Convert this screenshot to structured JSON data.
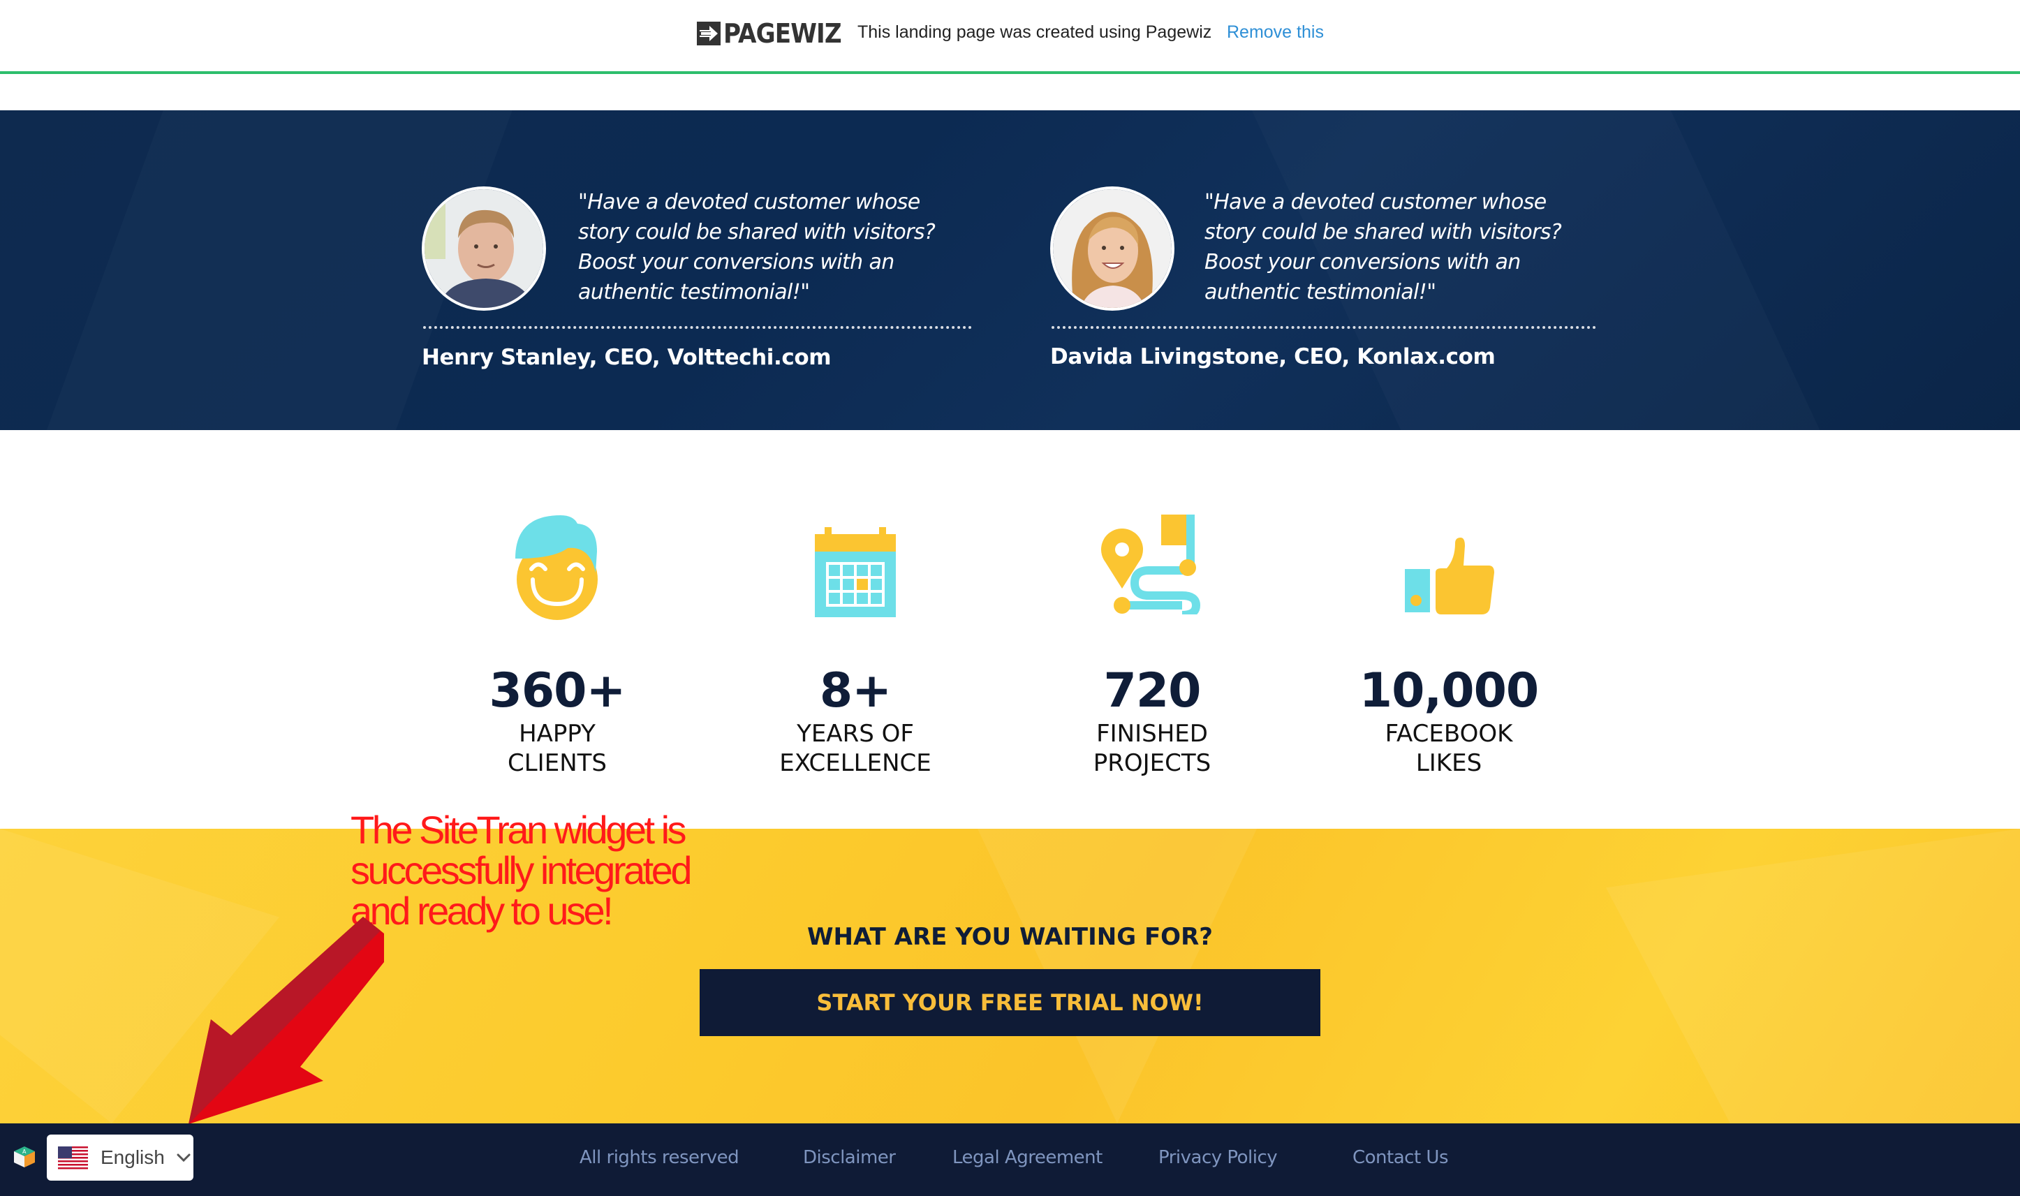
{
  "topbar": {
    "logo_text": "PAGEWIZ",
    "message": "This landing page was created using Pagewiz",
    "remove_link": "Remove this"
  },
  "testimonials": [
    {
      "quote": "\"Have a devoted customer whose story could be shared with visitors? Boost your conversions with an authentic testimonial!\"",
      "author": "Henry Stanley, CEO, Volttechi.com"
    },
    {
      "quote": "\"Have a devoted customer whose story could be shared with visitors? Boost your conversions with an authentic testimonial!\"",
      "author": "Davida Livingstone, CEO, Konlax.com"
    }
  ],
  "stats": [
    {
      "icon": "happy-face-icon",
      "value": "360+",
      "label_line1": "HAPPY",
      "label_line2": "CLIENTS"
    },
    {
      "icon": "calendar-icon",
      "value": "8+",
      "label_line1": "YEARS OF",
      "label_line2": "EXCELLENCE"
    },
    {
      "icon": "route-map-icon",
      "value": "720",
      "label_line1": "FINISHED",
      "label_line2": "PROJECTS"
    },
    {
      "icon": "thumbs-up-icon",
      "value": "10,000",
      "label_line1": "FACEBOOK",
      "label_line2": "LIKES"
    }
  ],
  "cta": {
    "heading": "WHAT ARE YOU WAITING FOR?",
    "button_label": "START YOUR FREE TRIAL NOW!"
  },
  "annotation": {
    "line1": "The SiteTran widget is",
    "line2": "successfully integrated",
    "line3": "and ready to use!"
  },
  "footer": {
    "links": [
      "All rights reserved",
      "Disclaimer",
      "Legal Agreement",
      "Privacy Policy",
      "Contact Us"
    ]
  },
  "language_widget": {
    "selected_language": "English",
    "flag": "us-flag-icon"
  },
  "colors": {
    "navy": "#0f1b36",
    "testimonial_bg": "#0e2a4f",
    "yellow": "#fcc92e",
    "accent_green": "#2dbe6c",
    "link_blue": "#2e8fd6",
    "annotation_red": "#ff1a1a",
    "icon_cyan": "#6ddfe8",
    "icon_yellow": "#fbc531"
  }
}
